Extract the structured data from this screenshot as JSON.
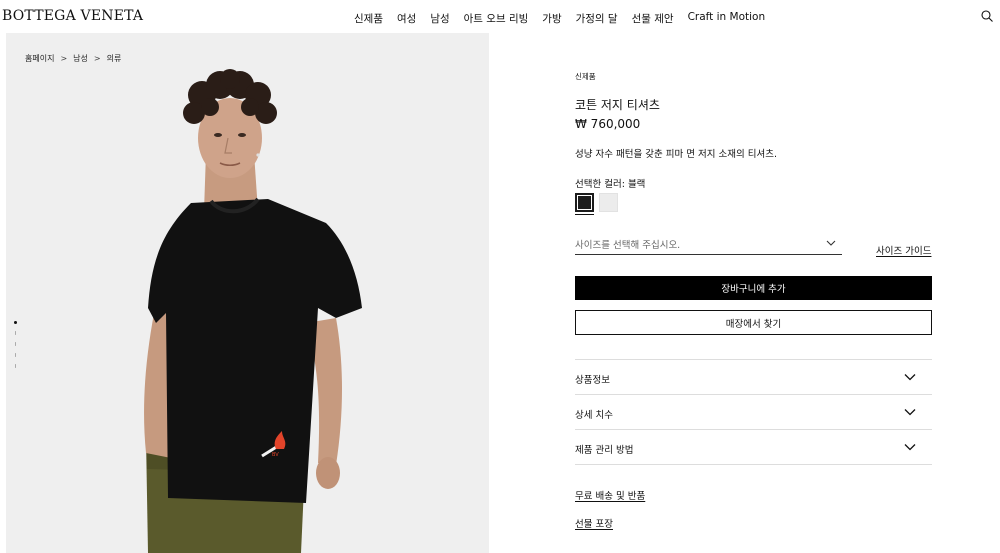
{
  "header": {
    "logo": "BOTTEGA VENETA",
    "nav": [
      "신제품",
      "여성",
      "남성",
      "아트 오브 리빙",
      "가방",
      "가정의 달",
      "선물 제안",
      "Craft in Motion"
    ],
    "search_icon": "search-icon"
  },
  "breadcrumb": {
    "items": [
      "홈페이지",
      "남성",
      "의류"
    ],
    "separator": ">"
  },
  "gallery": {
    "dots": 5,
    "active_dot": 0
  },
  "product": {
    "tag": "신제품",
    "title": "코튼 저지 티셔츠",
    "price": "₩ 760,000",
    "description": "성냥 자수 패턴을 갖춘 피마 면 저지 소재의 티셔츠.",
    "color_label": "선택한 컬러: 블랙",
    "colors": [
      {
        "name": "블랙",
        "hex": "#1c1c1c",
        "selected": true
      },
      {
        "name": "화이트",
        "hex": "#ececec",
        "selected": false
      }
    ],
    "size_placeholder": "사이즈를 선택해 주십시오.",
    "size_guide": "사이즈 가이드",
    "add_to_cart": "장바구니에 추가",
    "find_in_store": "매장에서 찾기",
    "accordion": [
      {
        "label": "상품정보"
      },
      {
        "label": "상세 치수"
      },
      {
        "label": "제품 관리 방법"
      }
    ],
    "links": {
      "shipping": "무료 배송 및 반품",
      "gift": "선물 포장"
    }
  },
  "colors": {
    "accent": "#000000",
    "panel_bg": "#efefef",
    "divider": "#dddddd"
  }
}
